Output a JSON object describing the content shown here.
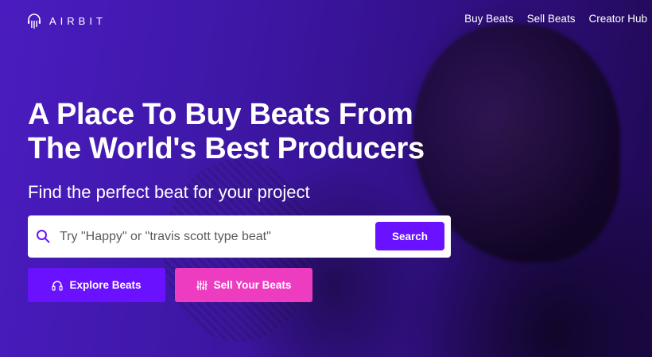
{
  "brand": {
    "name": "AIRBIT",
    "logo_icon": "airbit-logo-icon"
  },
  "nav": {
    "items": [
      {
        "label": "Buy Beats"
      },
      {
        "label": "Sell Beats"
      },
      {
        "label": "Creator Hub"
      }
    ]
  },
  "hero": {
    "title_line1": "A Place To Buy Beats From",
    "title_line2": "The World's Best Producers",
    "subtitle": "Find the perfect beat for your project"
  },
  "search": {
    "placeholder": "Try \"Happy\" or \"travis scott type beat\"",
    "value": "",
    "button_label": "Search",
    "icon": "search-icon"
  },
  "cta": {
    "explore_label": "Explore Beats",
    "explore_icon": "headphones-icon",
    "sell_label": "Sell Your Beats",
    "sell_icon": "equalizer-icon"
  },
  "colors": {
    "primary": "#6a11ff",
    "accent": "#ee3cc0",
    "hero_bg": "#3e17a6"
  }
}
